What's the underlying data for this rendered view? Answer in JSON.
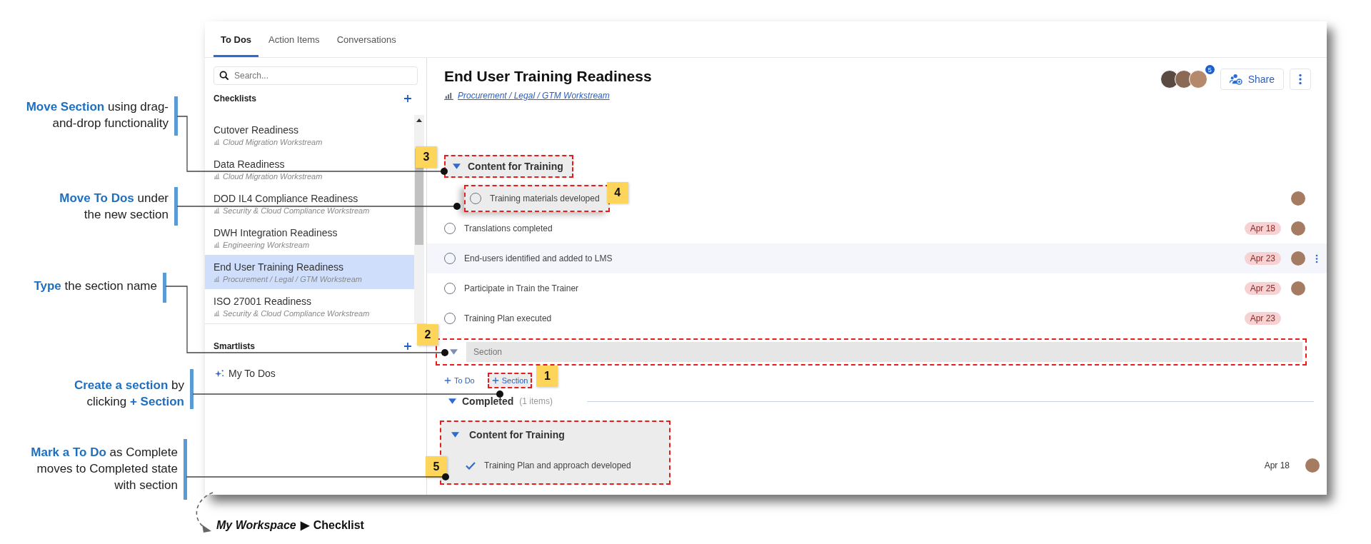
{
  "annotations": [
    {
      "text": "**Move Section** using drag-and-drop functionality"
    },
    {
      "text": "**Move To Dos** under the new section"
    },
    {
      "text": "**Type** the section name"
    },
    {
      "text": "**Create a section** by clicking **+ Section**"
    },
    {
      "text": "**Mark a To Do** as Complete moves to Completed state with section"
    }
  ],
  "tabs": [
    {
      "label": "To Dos",
      "selected": true
    },
    {
      "label": "Action Items",
      "selected": false
    },
    {
      "label": "Conversations",
      "selected": false
    }
  ],
  "sidebar": {
    "search": {
      "placeholder": "Search..."
    },
    "checklists": {
      "title": "Checklists",
      "items": [
        {
          "name": "Cutover Readiness",
          "workstream": "Cloud Migration Workstream",
          "selected": false
        },
        {
          "name": "Data Readiness",
          "workstream": "Cloud Migration Workstream",
          "selected": false
        },
        {
          "name": "DOD IL4 Compliance Readiness",
          "workstream": "Security & Cloud Compliance Workstream",
          "selected": false
        },
        {
          "name": "DWH Integration Readiness",
          "workstream": "Engineering Workstream",
          "selected": false
        },
        {
          "name": "End User Training Readiness",
          "workstream": "Procurement / Legal / GTM Workstream",
          "selected": true
        },
        {
          "name": "ISO 27001 Readiness",
          "workstream": "Security & Cloud Compliance Workstream",
          "selected": false
        }
      ]
    },
    "smartlists": {
      "title": "Smartlists",
      "items": [
        {
          "name": "My To Dos"
        }
      ]
    }
  },
  "checklist": {
    "title": "End User Training Readiness",
    "workstream": "Procurement / Legal / GTM Workstream",
    "member_count": "5",
    "share": "Share",
    "sections": [
      {
        "name": "Content for Training",
        "expanded": true,
        "highlighted": true,
        "badge": "3",
        "todos": [
          {
            "text": "Training materials developed",
            "done": false,
            "assigned": true,
            "hovered": false,
            "dragging": true,
            "badge": "4"
          },
          {
            "text": "Translations completed",
            "done": false,
            "due": "Apr 18",
            "overdue": true,
            "assigned": true,
            "hovered": false,
            "dragging": false
          },
          {
            "text": "End-users identified and added to LMS",
            "done": false,
            "due": "Apr 23",
            "overdue": true,
            "assigned": true,
            "hovered": true,
            "dragging": false
          },
          {
            "text": "Participate in Train the Trainer",
            "done": false,
            "due": "Apr 25",
            "overdue": true,
            "assigned": true,
            "hovered": false,
            "dragging": false
          },
          {
            "text": "Training Plan executed",
            "done": false,
            "due": "Apr 23",
            "overdue": true,
            "assigned": false,
            "hovered": false,
            "dragging": false
          }
        ]
      }
    ],
    "new_section": {
      "placeholder": "Section",
      "expanded": true,
      "highlighted": true,
      "badge": "2"
    },
    "add_buttons": [
      {
        "label": "To Do",
        "highlighted": false
      },
      {
        "label": "Section",
        "highlighted": true,
        "badge": "1"
      }
    ],
    "completed": {
      "label": "Completed",
      "count": "(1 items)",
      "expanded": true,
      "sections": [
        {
          "name": "Content for Training",
          "expanded": true,
          "highlighted": true,
          "badge": "5",
          "todos": [
            {
              "text": "Training Plan and approach developed",
              "done": true,
              "due": "Apr 18",
              "overdue": false,
              "assigned": true
            }
          ]
        }
      ]
    }
  },
  "breadcrumb": {
    "parts": [
      "My Workspace",
      "▶",
      "Checklist"
    ]
  }
}
